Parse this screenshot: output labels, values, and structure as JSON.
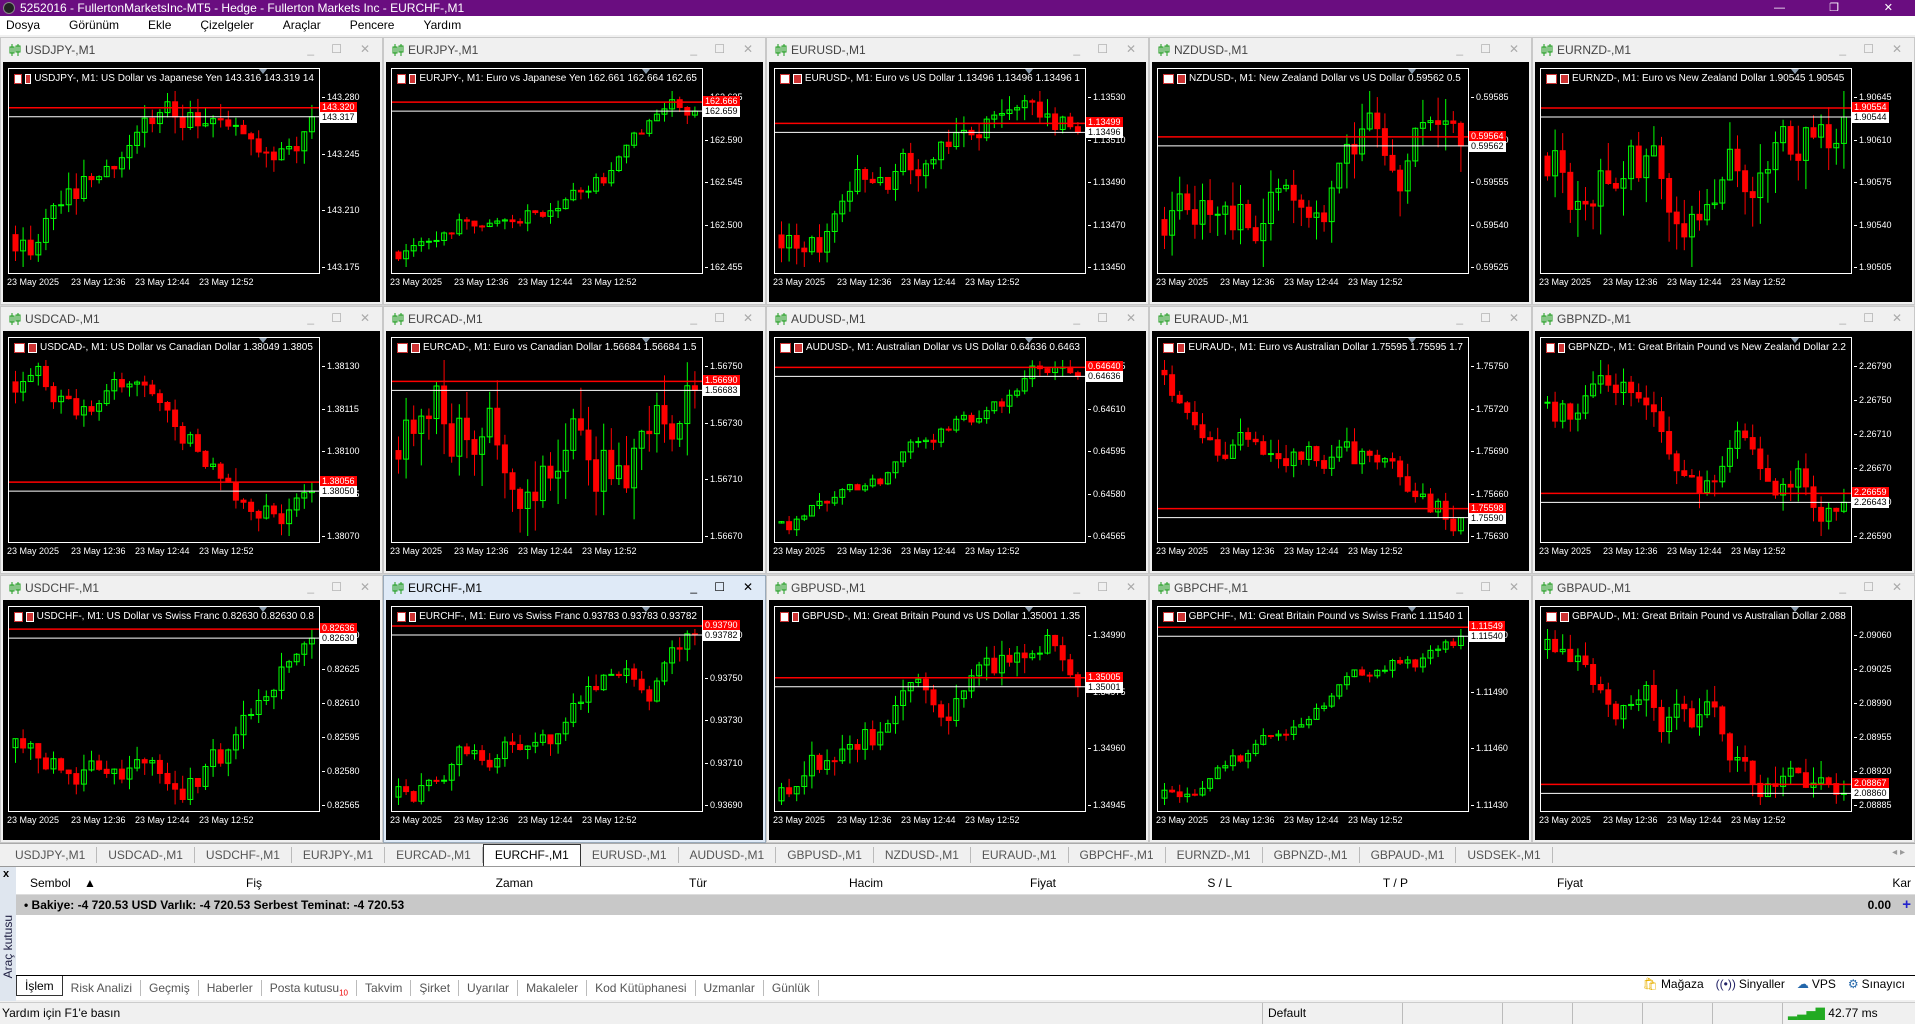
{
  "app": {
    "title": "5252016 - FullertonMarketsInc-MT5 - Hedge - Fullerton Markets Inc - EURCHF-,M1"
  },
  "menu": [
    "Dosya",
    "Görünüm",
    "Ekle",
    "Çizelgeler",
    "Araçlar",
    "Pencere",
    "Yardım"
  ],
  "time_labels": [
    "23 May 2025",
    "23 May 12:36",
    "23 May 12:44",
    "23 May 12:52"
  ],
  "colors": {
    "bull": "#00ff00",
    "bear": "#ff0000",
    "bg": "#000000",
    "titlebar": "#6a0d80"
  },
  "windows": [
    {
      "title": "USDJPY-,M1",
      "header": "USDJPY-, M1:  US Dollar vs Japanese Yen  143.316 143.319 14",
      "ticks": [
        "143.280",
        "143.245",
        "143.210",
        "143.175"
      ],
      "bid": "143.317",
      "ask": "143.320",
      "active": false,
      "trend": 0.6
    },
    {
      "title": "EURJPY-,M1",
      "header": "EURJPY-, M1:  Euro vs Japanese Yen  162.661 162.664 162.65",
      "ticks": [
        "162.635",
        "162.590",
        "162.545",
        "162.500",
        "162.455"
      ],
      "bid": "162.659",
      "ask": "162.666",
      "active": false,
      "trend": 0.8
    },
    {
      "title": "EURUSD-,M1",
      "header": "EURUSD-, M1:  Euro vs US Dollar  1.13496 1.13496 1.13496 1",
      "ticks": [
        "1.13530",
        "1.13510",
        "1.13490",
        "1.13470",
        "1.13450"
      ],
      "bid": "1.13496",
      "ask": "1.13499",
      "active": false,
      "trend": 0.3
    },
    {
      "title": "NZDUSD-,M1",
      "header": "NZDUSD-, M1:  New Zealand Dollar vs US Dollar  0.59562 0.5",
      "ticks": [
        "0.59585",
        "0.59570",
        "0.59555",
        "0.59540",
        "0.59525"
      ],
      "bid": "0.59562",
      "ask": "0.59564",
      "active": false,
      "trend": 0.4
    },
    {
      "title": "EURNZD-,M1",
      "header": "EURNZD-, M1:  Euro vs New Zealand Dollar  1.90545 1.90545",
      "ticks": [
        "1.90645",
        "1.90610",
        "1.90575",
        "1.90540",
        "1.90505"
      ],
      "bid": "1.90544",
      "ask": "1.90554",
      "active": false,
      "trend": -0.1
    },
    {
      "title": "USDCAD-,M1",
      "header": "USDCAD-, M1:  US Dollar vs Canadian Dollar  1.38049 1.3805",
      "ticks": [
        "1.38130",
        "1.38115",
        "1.38100",
        "1.38085",
        "1.38070"
      ],
      "bid": "1.38050",
      "ask": "1.38056",
      "active": false,
      "trend": -0.6
    },
    {
      "title": "EURCAD-,M1",
      "header": "EURCAD-, M1:  Euro vs Canadian Dollar  1.56684 1.56684 1.5",
      "ticks": [
        "1.56750",
        "1.56730",
        "1.56710",
        "1.56670"
      ],
      "bid": "1.56683",
      "ask": "1.56690",
      "active": false,
      "trend": 0.1
    },
    {
      "title": "AUDUSD-,M1",
      "header": "AUDUSD-, M1:  Australian Dollar vs US Dollar  0.64636 0.6463",
      "ticks": [
        "0.64625",
        "0.64610",
        "0.64595",
        "0.64580",
        "0.64565"
      ],
      "bid": "0.64636",
      "ask": "0.64640",
      "active": false,
      "trend": 0.7
    },
    {
      "title": "EURAUD-,M1",
      "header": "EURAUD-, M1:  Euro vs Australian Dollar  1.75595 1.75595 1.7",
      "ticks": [
        "1.75750",
        "1.75720",
        "1.75690",
        "1.75660",
        "1.75630"
      ],
      "bid": "1.75590",
      "ask": "1.75598",
      "active": false,
      "trend": -0.7
    },
    {
      "title": "GBPNZD-,M1",
      "header": "GBPNZD-, M1:  Great Britain Pound vs New Zealand Dollar  2.2",
      "ticks": [
        "2.26790",
        "2.26750",
        "2.26710",
        "2.26670",
        "2.26630",
        "2.26590"
      ],
      "bid": "2.26643",
      "ask": "2.26659",
      "active": false,
      "trend": -0.3
    },
    {
      "title": "USDCHF-,M1",
      "header": "USDCHF-, M1:  US Dollar vs Swiss Franc  0.82630 0.82630 0.8",
      "ticks": [
        "0.82640",
        "0.82625",
        "0.82610",
        "0.82595",
        "0.82580",
        "0.82565"
      ],
      "bid": "0.82630",
      "ask": "0.82636",
      "active": false,
      "trend": 0.6
    },
    {
      "title": "EURCHF-,M1",
      "header": "EURCHF-, M1:  Euro vs Swiss Franc  0.93783 0.93783 0.93782",
      "ticks": [
        "0.93770",
        "0.93750",
        "0.93730",
        "0.93710",
        "0.93690"
      ],
      "bid": "0.93782",
      "ask": "0.93790",
      "active": true,
      "trend": 0.8
    },
    {
      "title": "GBPUSD-,M1",
      "header": "GBPUSD-, M1:  Great Britain Pound vs US Dollar  1.35001 1.35",
      "ticks": [
        "1.34990",
        "1.34975",
        "1.34960",
        "1.34945"
      ],
      "bid": "1.35001",
      "ask": "1.35005",
      "active": false,
      "trend": 0.5
    },
    {
      "title": "GBPCHF-,M1",
      "header": "GBPCHF-, M1:  Great Britain Pound vs Swiss Franc  1.11540 1",
      "ticks": [
        "1.11520",
        "1.11490",
        "1.11460",
        "1.11430"
      ],
      "bid": "1.11540",
      "ask": "1.11549",
      "active": false,
      "trend": 0.6
    },
    {
      "title": "GBPAUD-,M1",
      "header": "GBPAUD-, M1:  Great Britain Pound vs Australian Dollar  2.088",
      "ticks": [
        "2.09060",
        "2.09025",
        "2.08990",
        "2.08955",
        "2.08920",
        "2.08885"
      ],
      "bid": "2.08860",
      "ask": "2.08867",
      "active": false,
      "trend": -0.8
    }
  ],
  "chart_tabs": [
    "USDJPY-,M1",
    "USDCAD-,M1",
    "USDCHF-,M1",
    "EURJPY-,M1",
    "EURCAD-,M1",
    "EURCHF-,M1",
    "EURUSD-,M1",
    "AUDUSD-,M1",
    "GBPUSD-,M1",
    "NZDUSD-,M1",
    "EURAUD-,M1",
    "GBPCHF-,M1",
    "EURNZD-,M1",
    "GBPNZD-,M1",
    "GBPAUD-,M1",
    "USDSEK-,M1"
  ],
  "active_tab": "EURCHF-,M1",
  "toolbox": {
    "side_label": "Araç kutusu",
    "columns": [
      "Sembol",
      "Fiş",
      "Zaman",
      "Tür",
      "Hacim",
      "Fiyat",
      "S / L",
      "T / P",
      "Fiyat",
      "Kar"
    ],
    "balance_text": "Bakiye: -4 720.53 USD  Varlık: -4 720.53  Serbest Teminat: -4 720.53",
    "profit": "0.00",
    "tabs": [
      "İşlem",
      "Risk Analizi",
      "Geçmiş",
      "Haberler",
      "Posta kutusu",
      "Takvim",
      "Şirket",
      "Uyarılar",
      "Makaleler",
      "Kod Kütüphanesi",
      "Uzmanlar",
      "Günlük"
    ],
    "mail_count": "10",
    "right_links": [
      "Mağaza",
      "Sinyaller",
      "VPS",
      "Sınayıcı"
    ]
  },
  "status": {
    "help": "Yardım için F1'e basın",
    "profile": "Default",
    "ping": "42.77 ms"
  }
}
